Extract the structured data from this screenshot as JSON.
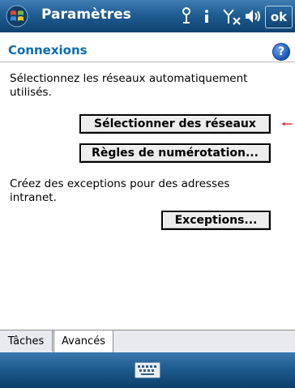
{
  "titlebar": {
    "title": "Paramètres",
    "ok_label": "ok"
  },
  "section": {
    "title": "Connexions",
    "help": "?"
  },
  "main": {
    "desc1": "Sélectionnez les réseaux automatiquement utilisés.",
    "select_networks_button": "Sélectionner des réseaux",
    "dialing_rules_button": "Règles de numérotation...",
    "desc2": "Créez des exceptions pour des adresses intranet.",
    "exceptions_button": "Exceptions..."
  },
  "tabs": [
    "Tâches",
    "Avancés"
  ],
  "colors": {
    "titlebar": "#1f5d92",
    "section_title": "#0a6bb6",
    "pointer": "#d8201e"
  }
}
